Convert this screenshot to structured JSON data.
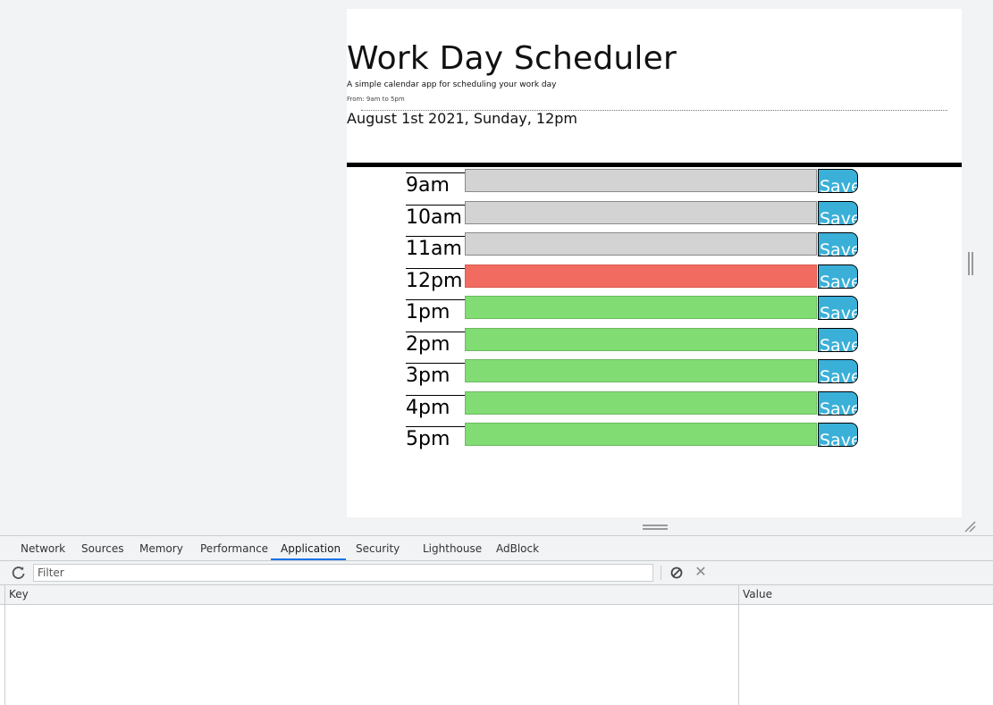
{
  "page": {
    "title": "Work Day Scheduler",
    "lead": "A simple calendar app for scheduling your work day",
    "sublead": "From: 9am to 5pm",
    "current_day": "August 1st 2021, Sunday, 12pm"
  },
  "rows": [
    {
      "hour": "9am",
      "save": "Save",
      "status": "past"
    },
    {
      "hour": "10am",
      "save": "Save",
      "status": "past"
    },
    {
      "hour": "11am",
      "save": "Save",
      "status": "past"
    },
    {
      "hour": "12pm",
      "save": "Save",
      "status": "present"
    },
    {
      "hour": "1pm",
      "save": "Save",
      "status": "future"
    },
    {
      "hour": "2pm",
      "save": "Save",
      "status": "future"
    },
    {
      "hour": "3pm",
      "save": "Save",
      "status": "future"
    },
    {
      "hour": "4pm",
      "save": "Save",
      "status": "future"
    },
    {
      "hour": "5pm",
      "save": "Save",
      "status": "future"
    }
  ],
  "colors": {
    "past": "#d3d3d3",
    "present": "#f26b61",
    "future": "#82dc74",
    "save": "#3ab0d8"
  },
  "devtools": {
    "tabs": [
      "Network",
      "Sources",
      "Memory",
      "Performance",
      "Application",
      "Security",
      "Lighthouse",
      "AdBlock"
    ],
    "active_tab": "Application",
    "filter_placeholder": "Filter",
    "columns": {
      "key": "Key",
      "value": "Value"
    },
    "icons": {
      "refresh": "refresh-icon",
      "clear": "clear-all-icon",
      "delete": "delete-selected-icon"
    }
  }
}
